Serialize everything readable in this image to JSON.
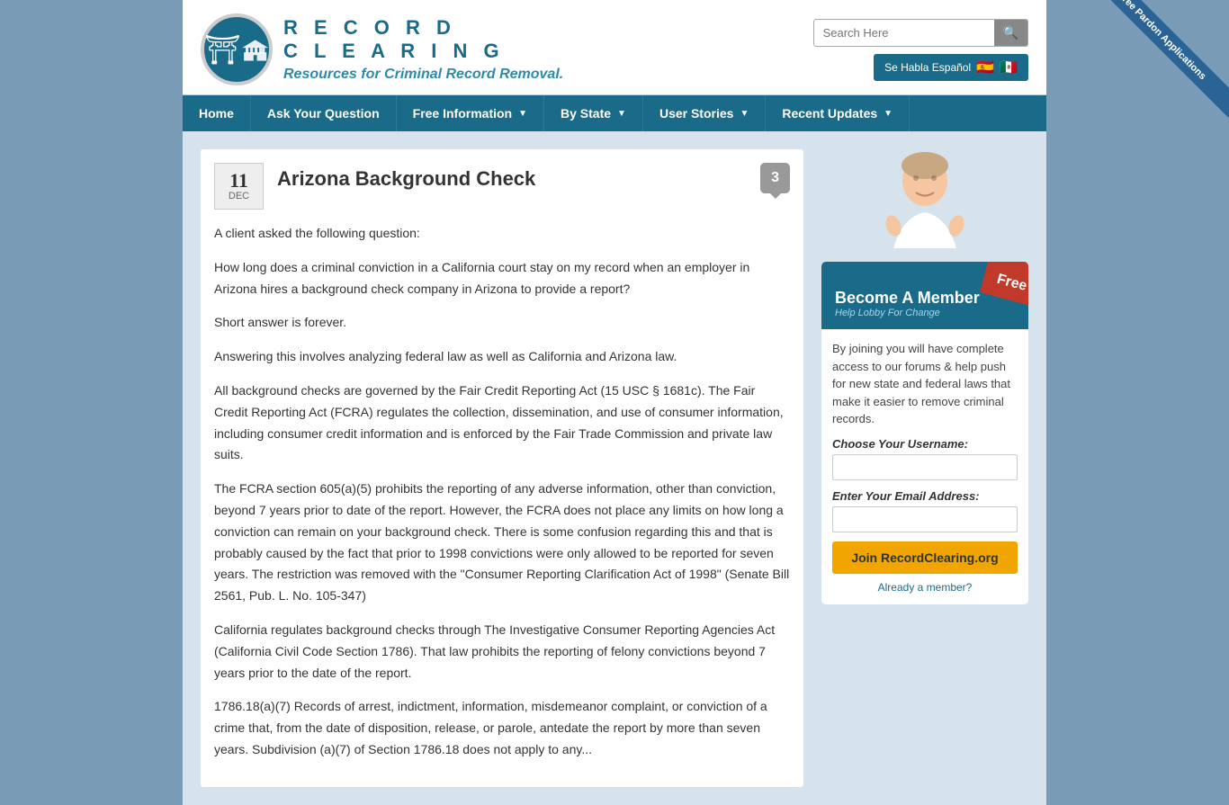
{
  "ribbon": {
    "text": "Free Pardon Applications"
  },
  "header": {
    "logo_name_line1": "R E C O R D",
    "logo_name_line2": "C L E A R I N G",
    "tagline": "Resources for Criminal Record Removal.",
    "search_placeholder": "Search Here",
    "language_label": "Se Habla Español"
  },
  "nav": {
    "items": [
      {
        "label": "Home",
        "has_caret": false
      },
      {
        "label": "Ask Your Question",
        "has_caret": false
      },
      {
        "label": "Free Information",
        "has_caret": true
      },
      {
        "label": "By State",
        "has_caret": true
      },
      {
        "label": "User Stories",
        "has_caret": true
      },
      {
        "label": "Recent Updates",
        "has_caret": true
      }
    ]
  },
  "article": {
    "date_day": "11",
    "date_month": "DEC",
    "title": "Arizona Background Check",
    "comment_count": "3",
    "paragraphs": [
      "A client asked the following question:",
      "How long does a criminal conviction in a California court stay on my record when an employer in Arizona hires a background check company in Arizona to provide a report?",
      "Short answer is forever.",
      "Answering this involves analyzing federal law as well as California and Arizona law.",
      "All background checks are governed by the Fair Credit Reporting Act (15 USC § 1681c). The Fair Credit Reporting Act (FCRA) regulates the collection, dissemination, and use of consumer information, including consumer credit information and is enforced by the Fair Trade Commission and private law suits.",
      "The FCRA section 605(a)(5) prohibits the reporting of any adverse information, other than conviction, beyond 7 years prior to date of the report. However, the FCRA does not place any limits on how long a conviction can remain on your background check. There is some confusion regarding this and that is probably caused by the fact that prior to 1998 convictions were only allowed to be reported for seven years. The restriction was removed with the \"Consumer Reporting Clarification Act of 1998\" (Senate Bill 2561, Pub. L. No. 105-347)",
      "California regulates background checks through The Investigative Consumer Reporting Agencies Act (California Civil Code Section 1786). That law prohibits the reporting of felony convictions beyond 7 years prior to the date of the report.",
      "1786.18(a)(7) Records of arrest, indictment, information, misdemeanor complaint, or conviction of a crime that, from the date of disposition, release, or parole, antedate the report by more than seven years. Subdivision (a)(7) of Section 1786.18 does not apply to any..."
    ]
  },
  "sidebar": {
    "member_title": "Become A Member",
    "member_subtitle": "Help Lobby For Change",
    "free_badge": "Free",
    "description": "By joining you will have complete access to our forums & help push for new state and federal laws that make it easier to remove criminal records.",
    "username_label": "Choose Your Username:",
    "email_label": "Enter Your Email Address:",
    "join_button": "Join RecordClearing.org",
    "already_member": "Already a member?"
  }
}
